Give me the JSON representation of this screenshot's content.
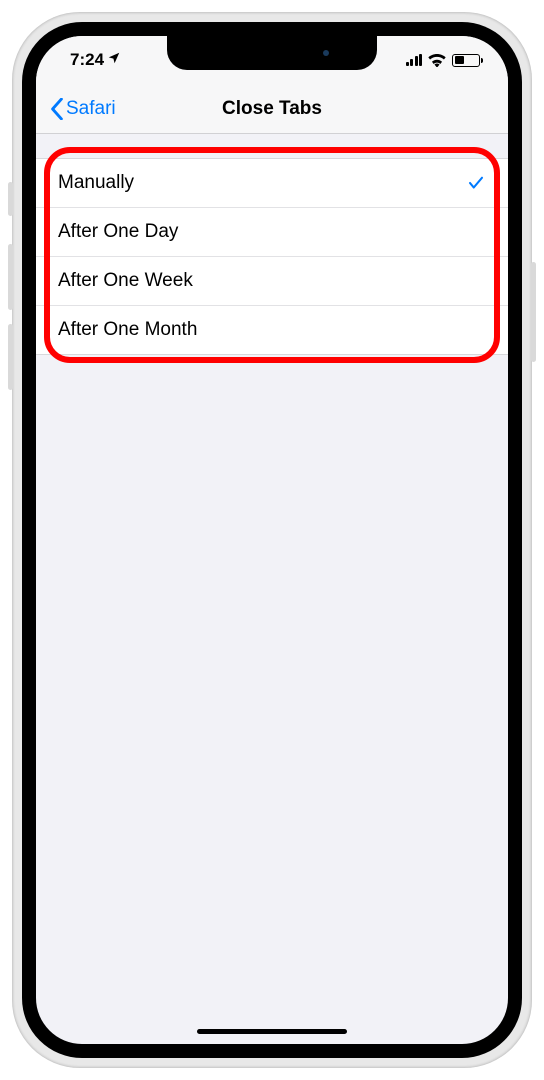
{
  "status": {
    "time": "7:24",
    "location_active": true
  },
  "nav": {
    "back_label": "Safari",
    "title": "Close Tabs"
  },
  "options": [
    {
      "label": "Manually",
      "selected": true
    },
    {
      "label": "After One Day",
      "selected": false
    },
    {
      "label": "After One Week",
      "selected": false
    },
    {
      "label": "After One Month",
      "selected": false
    }
  ],
  "annotation": {
    "highlight_color": "#ff0000"
  }
}
